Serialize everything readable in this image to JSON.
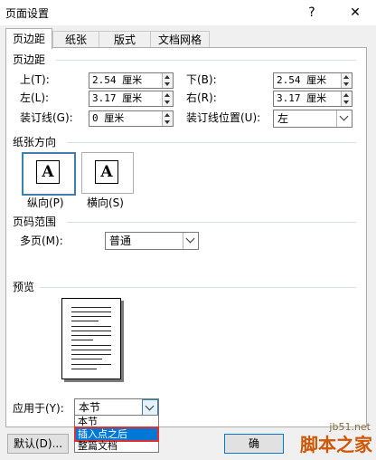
{
  "window": {
    "title": "页面设置",
    "help": "?",
    "close": "✕"
  },
  "tabs": [
    {
      "label": "页边距"
    },
    {
      "label": "纸张"
    },
    {
      "label": "版式"
    },
    {
      "label": "文档网格"
    }
  ],
  "margins": {
    "section": "页边距",
    "top_label": "上(T):",
    "top_value": "2.54 厘米",
    "bottom_label": "下(B):",
    "bottom_value": "2.54 厘米",
    "left_label": "左(L):",
    "left_value": "3.17 厘米",
    "right_label": "右(R):",
    "right_value": "3.17 厘米",
    "gutter_label": "装订线(G):",
    "gutter_value": "0 厘米",
    "gutter_pos_label": "装订线位置(U):",
    "gutter_pos_value": "左"
  },
  "orientation": {
    "section": "纸张方向",
    "portrait_label": "纵向(P)",
    "landscape_label": "横向(S)",
    "icon_glyph": "A",
    "selected": "portrait"
  },
  "pages": {
    "section": "页码范围",
    "multi_label": "多页(M):",
    "multi_value": "普通"
  },
  "preview": {
    "section": "预览"
  },
  "apply": {
    "label": "应用于(Y):",
    "value": "本节",
    "options": [
      "本节",
      "插入点之后",
      "整篇文档"
    ],
    "highlighted": "插入点之后"
  },
  "buttons": {
    "default": "默认(D)...",
    "ok": "确"
  },
  "watermark": {
    "site": "jb51.net",
    "brand": "脚本之家"
  }
}
